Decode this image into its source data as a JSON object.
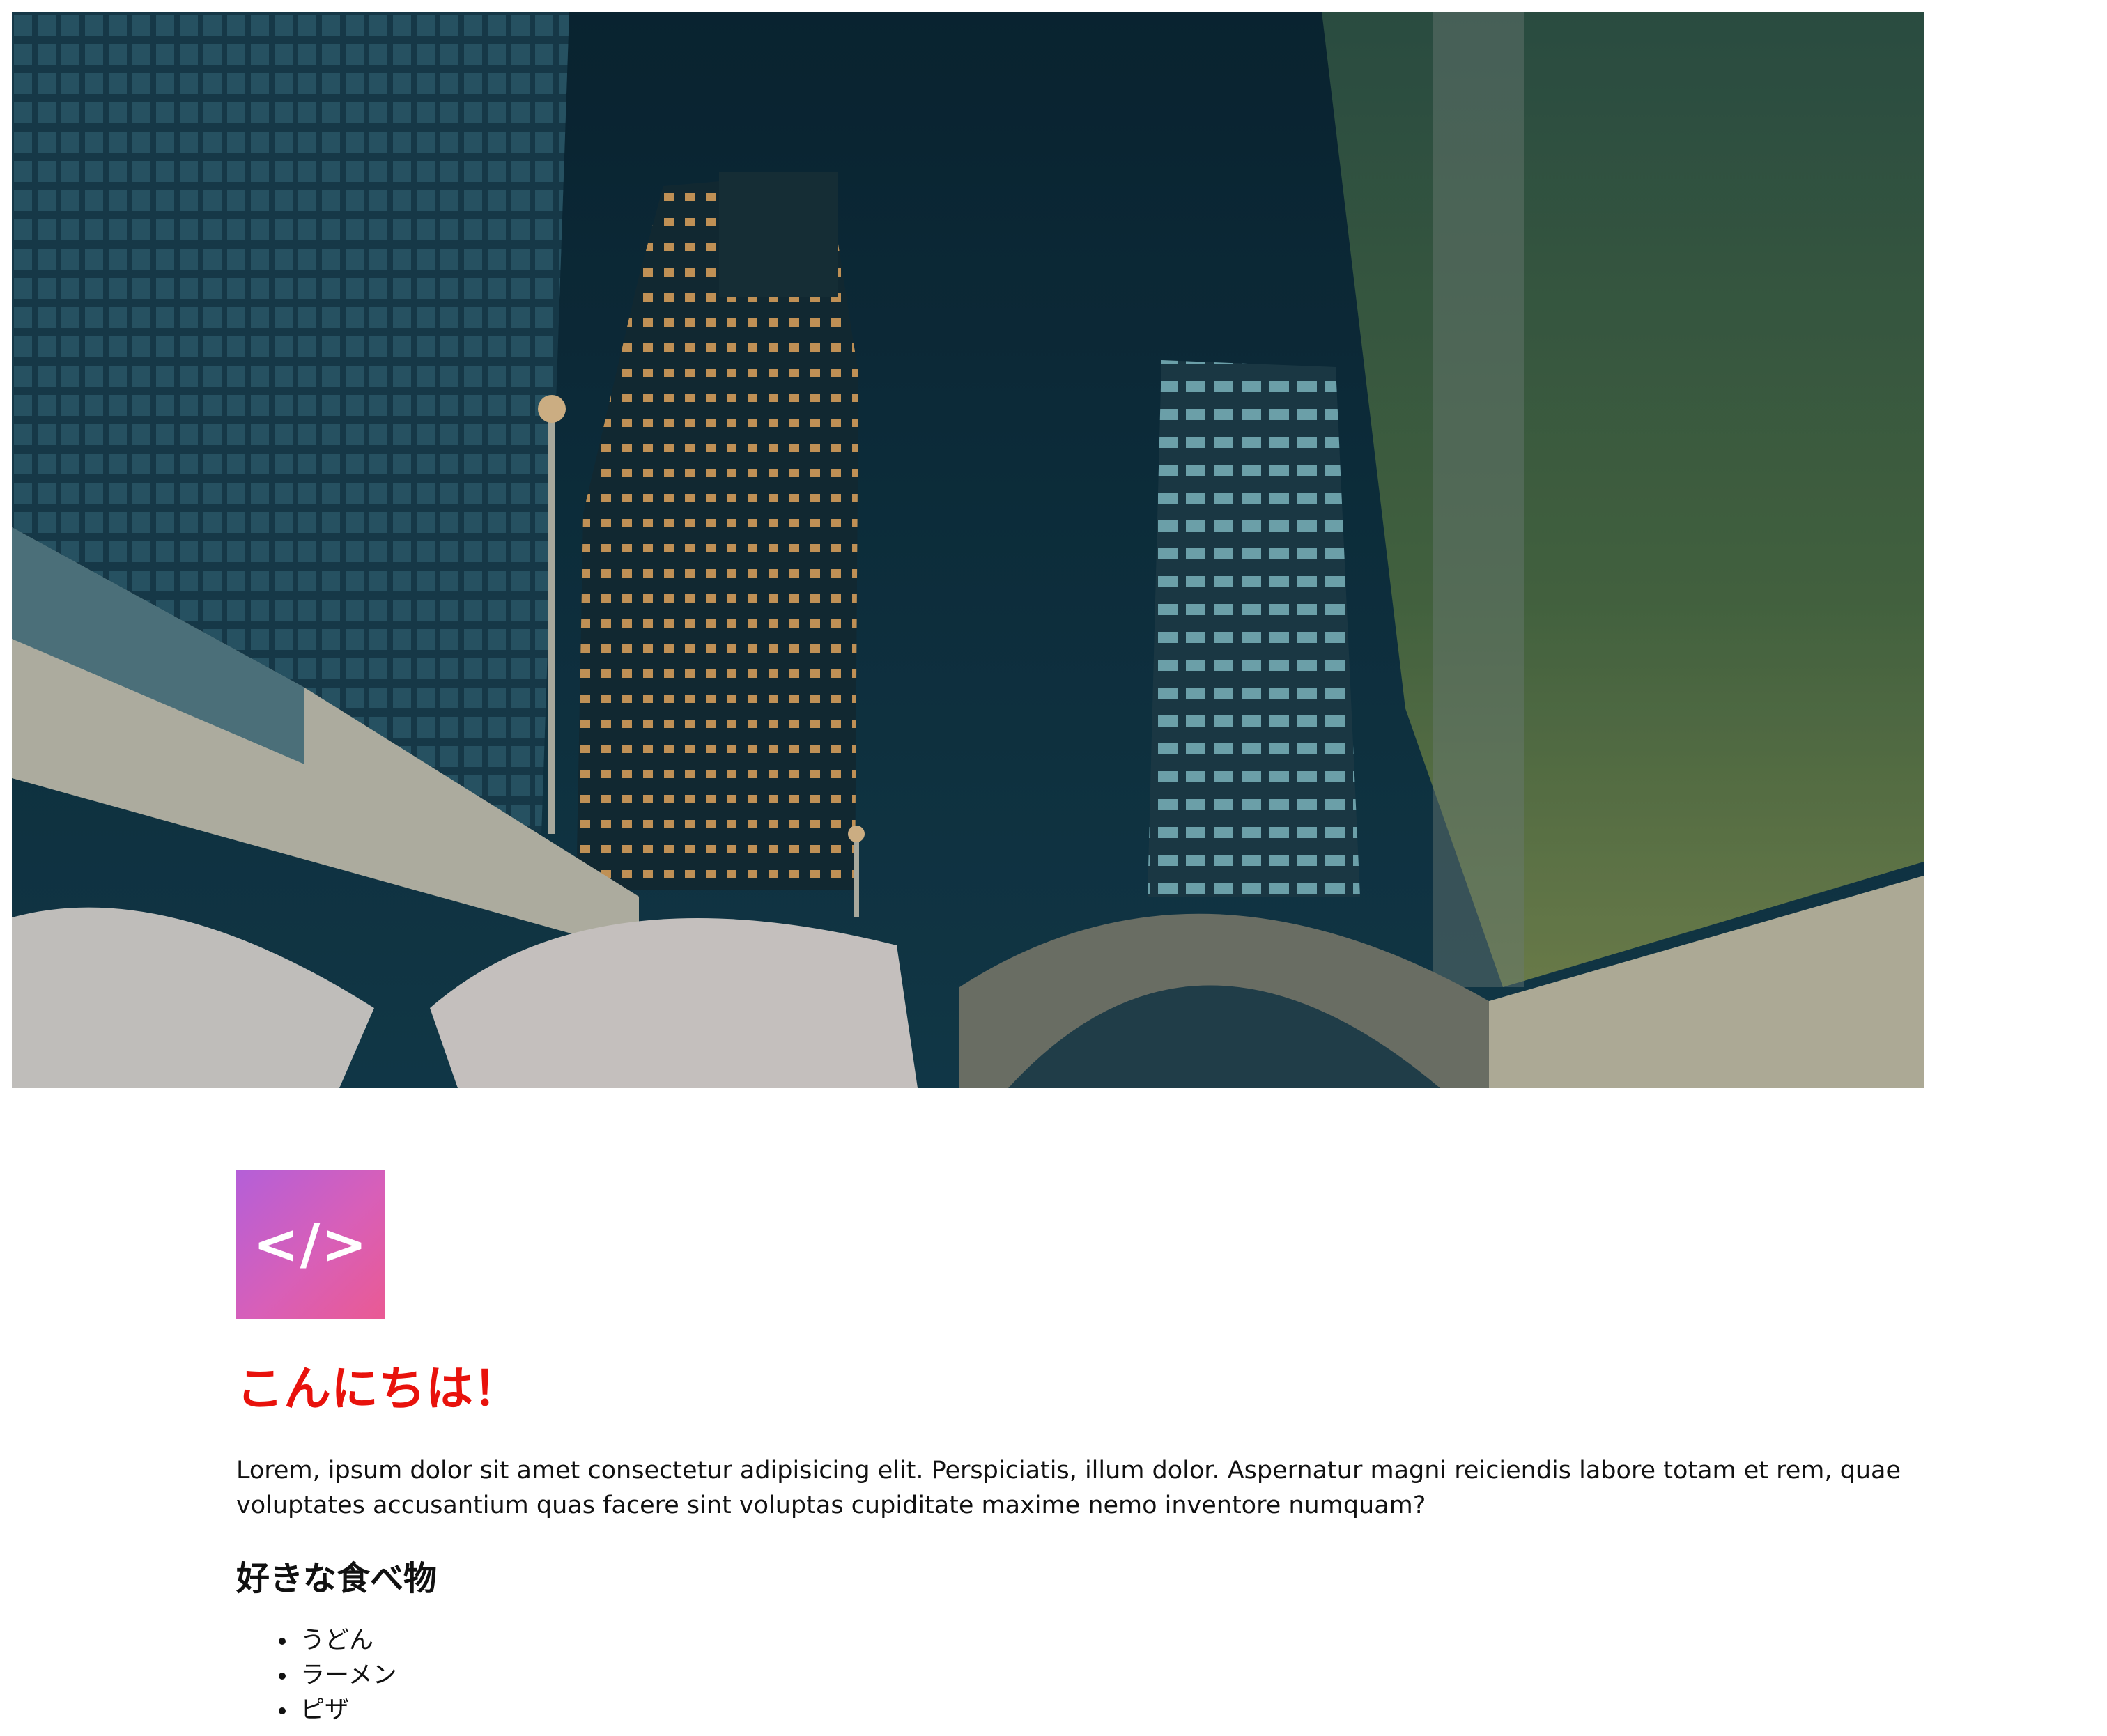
{
  "hero": {
    "image_icon": "city-night-photo",
    "colors": {
      "sky": "#0c2a38",
      "overlay_tint": "#0e3340"
    }
  },
  "logo": {
    "glyph": "</>",
    "icon": "code-icon",
    "gradient": [
      "#b45fd8",
      "#ea5a93"
    ]
  },
  "greeting": "こんにちは！",
  "intro": "Lorem, ipsum dolor sit amet consectetur adipisicing elit. Perspiciatis, illum dolor. Aspernatur magni reiciendis labore totam et rem, quae voluptates accusantium quas facere sint voluptas cupiditate maxime nemo inventore numquam?",
  "favorites": {
    "heading": "好きな食べ物",
    "items": [
      "うどん",
      "ラーメン",
      "ピザ"
    ]
  },
  "colors": {
    "greeting": "#e8120c",
    "text": "#111111",
    "background": "#ffffff"
  }
}
